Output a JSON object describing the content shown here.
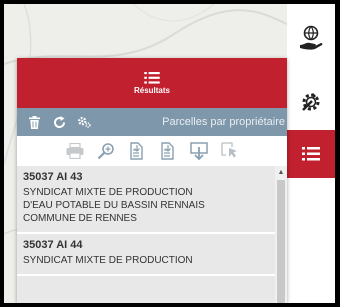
{
  "panel": {
    "title": "Résultats",
    "toolbar_label": "Parcelles par propriétaire"
  },
  "icons": {
    "header": "list-icon",
    "toolbar": [
      "trash-icon",
      "refresh-icon",
      "settings-icon"
    ],
    "actions": [
      "print-icon",
      "zoom-to-icon",
      "export-csv-icon",
      "export-csv-icon",
      "download-icon",
      "select-icon"
    ],
    "rail": [
      "globe-hand-icon",
      "gear-icon",
      "list-icon"
    ]
  },
  "results": [
    {
      "ref": "35037 AI 43",
      "owner_lines": [
        "SYNDICAT MIXTE DE PRODUCTION",
        "D'EAU POTABLE DU BASSIN RENNAIS",
        "COMMUNE DE RENNES"
      ]
    },
    {
      "ref": "35037 AI 44",
      "owner_lines": [
        "SYNDICAT MIXTE DE PRODUCTION"
      ]
    }
  ],
  "colors": {
    "accent": "#c1202e",
    "toolbar": "#7e97aa",
    "list_bg": "#e8e8e8"
  }
}
